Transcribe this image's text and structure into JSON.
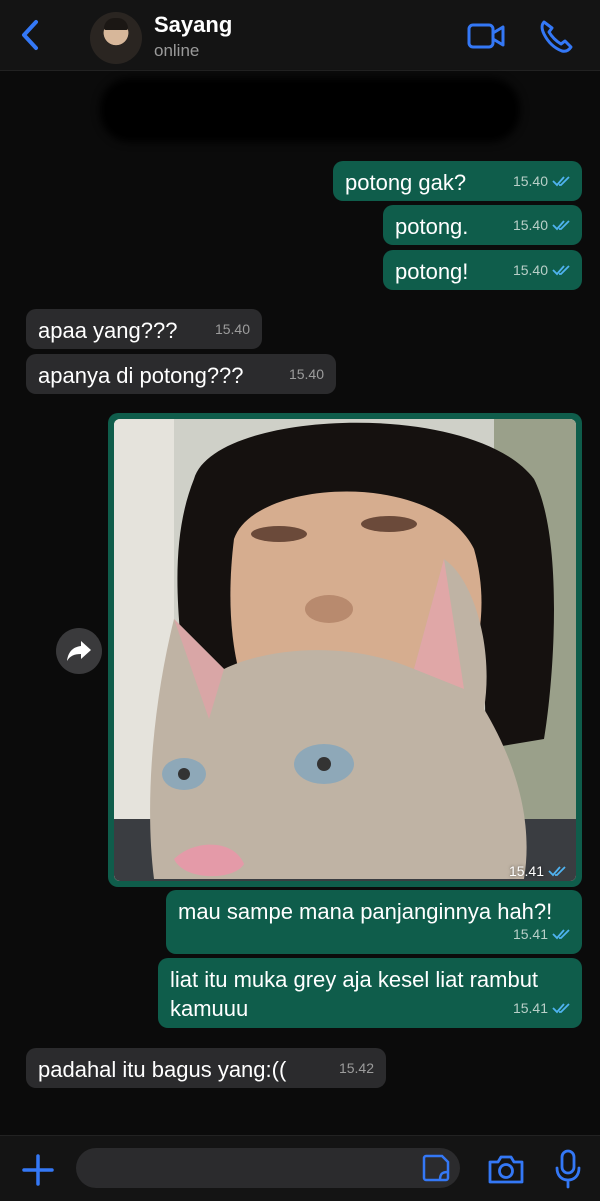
{
  "header": {
    "contact_name": "Sayang",
    "status": "online"
  },
  "messages": [
    {
      "side": "out",
      "text": "potong gak?",
      "time": "15.40",
      "read": true
    },
    {
      "side": "out",
      "text": "potong.",
      "time": "15.40",
      "read": true
    },
    {
      "side": "out",
      "text": "potong!",
      "time": "15.40",
      "read": true
    },
    {
      "side": "in",
      "text": "apaa yang???",
      "time": "15.40"
    },
    {
      "side": "in",
      "text": "apanya di potong???",
      "time": "15.40"
    },
    {
      "side": "out",
      "type": "image",
      "time": "15.41",
      "read": true
    },
    {
      "side": "out",
      "text": "mau sampe mana panjanginnya hah?!",
      "time": "15.41",
      "read": true
    },
    {
      "side": "out",
      "text_line1": "liat itu muka grey aja kesel liat rambut",
      "text_line2": "kamuuu",
      "time": "15.41",
      "read": true
    },
    {
      "side": "in",
      "text": "padahal itu bagus yang:((",
      "time": "15.42"
    }
  ],
  "icons": {
    "back": "chevron-left-icon",
    "video": "video-camera-icon",
    "call": "phone-icon",
    "forward": "forward-arrow-icon",
    "plus": "plus-icon",
    "sticker": "sticker-icon",
    "camera": "camera-icon",
    "mic": "microphone-icon",
    "read": "double-check-icon"
  },
  "colors": {
    "accent": "#3478f6",
    "outgoing_bubble": "#0f5d4b",
    "incoming_bubble": "#2b2b2d",
    "background": "#0b0b0b"
  }
}
